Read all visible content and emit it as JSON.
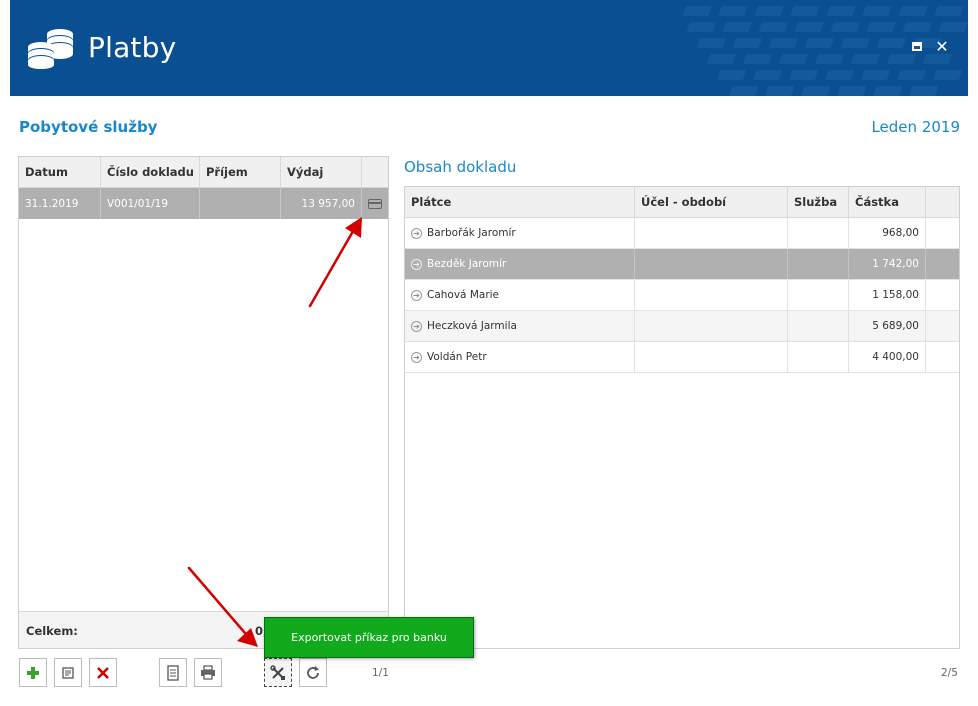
{
  "window": {
    "title": "Platby"
  },
  "header": {
    "section_title": "Pobytové služby",
    "period": "Leden 2019"
  },
  "left_table": {
    "columns": [
      "Datum",
      "Číslo dokladu",
      "Příjem",
      "Výdaj"
    ],
    "rows": [
      {
        "datum": "31.1.2019",
        "cislo": "V001/01/19",
        "prijem": "",
        "vydaj": "13 957,00"
      }
    ],
    "total_label": "Celkem:",
    "total_value": "0,"
  },
  "right_section": {
    "title": "Obsah dokladu",
    "columns": [
      "Plátce",
      "Účel - období",
      "Služba",
      "Částka"
    ],
    "rows": [
      {
        "platce": "Barbořák Jaromír",
        "ucel": "",
        "sluzba": "",
        "castka": "968,00"
      },
      {
        "platce": "Bezděk Jaromír",
        "ucel": "",
        "sluzba": "",
        "castka": "1 742,00"
      },
      {
        "platce": "Cahová Marie",
        "ucel": "",
        "sluzba": "",
        "castka": "1 158,00"
      },
      {
        "platce": "Heczková Jarmila",
        "ucel": "",
        "sluzba": "",
        "castka": "5 689,00"
      },
      {
        "platce": "Voldán Petr",
        "ucel": "",
        "sluzba": "",
        "castka": "4 400,00"
      }
    ],
    "selected_row": 1
  },
  "toolbar": {
    "buttons": [
      "add-icon",
      "edit-icon",
      "delete-icon",
      "document-icon",
      "print-icon",
      "tools-icon",
      "refresh-icon"
    ],
    "tooltip": "Exportovat příkaz pro banku",
    "pager_left": "1/1",
    "pager_right": "2/5"
  },
  "colors": {
    "header_bg": "#0a4f91",
    "accent": "#1a88c8",
    "selected_row": "#b0b0b0",
    "tooltip_bg": "#12aa1d",
    "annotation_arrow": "#d40000"
  }
}
